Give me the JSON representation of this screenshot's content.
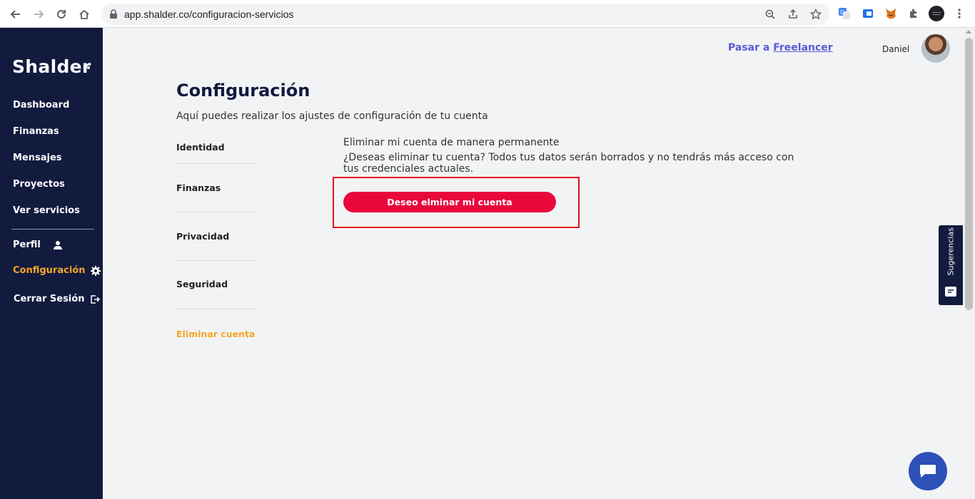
{
  "browser": {
    "url": "app.shalder.co/configuracion-servicios"
  },
  "sidebar": {
    "logo": "Shalder",
    "items": [
      {
        "label": "Dashboard"
      },
      {
        "label": "Finanzas"
      },
      {
        "label": "Mensajes"
      },
      {
        "label": "Proyectos"
      },
      {
        "label": "Ver servicios"
      }
    ],
    "account": [
      {
        "label": "Perfil",
        "icon": "user-icon"
      },
      {
        "label": "Configuración",
        "icon": "gear-icon",
        "active": true
      },
      {
        "label": "Cerrar Sesión",
        "icon": "logout-icon"
      }
    ]
  },
  "header": {
    "switch_prefix": "Pasar a",
    "switch_link": "Freelancer",
    "username": "Daniel"
  },
  "main": {
    "title": "Configuración",
    "subtitle": "Aquí puedes realizar los ajustes de configuración de tu cuenta",
    "tabs": [
      {
        "label": "Identidad"
      },
      {
        "label": "Finanzas"
      },
      {
        "label": "Privacidad"
      },
      {
        "label": "Seguridad"
      },
      {
        "label": "Eliminar cuenta",
        "active": true
      }
    ],
    "section_title": "Eliminar mi cuenta de manera permanente",
    "section_desc": "¿Deseas eliminar tu cuenta? Todos tus datos serán borrados y no tendrás más acceso con tus credenciales actuales.",
    "delete_button": "Deseo elminar mi cuenta"
  },
  "feedback_tab": {
    "label": "Sugerencias"
  },
  "colors": {
    "sidebar_bg": "#121a3e",
    "accent": "#f5a623",
    "danger": "#e8083c",
    "link": "#5b5bd6",
    "chat": "#2d51b8"
  }
}
